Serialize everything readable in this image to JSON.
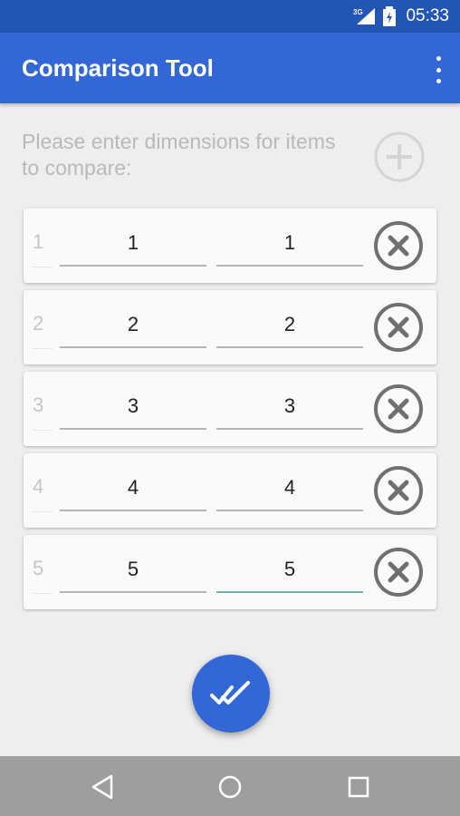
{
  "status_bar": {
    "time": "05:33",
    "network_label": "3G"
  },
  "app_bar": {
    "title": "Comparison Tool",
    "menu_icon": "more-vert-icon"
  },
  "prompt": {
    "text": "Please enter dimensions for items to compare:"
  },
  "rows": [
    {
      "index": "1",
      "value_a": "1",
      "value_b": "1"
    },
    {
      "index": "2",
      "value_a": "2",
      "value_b": "2"
    },
    {
      "index": "3",
      "value_a": "3",
      "value_b": "3"
    },
    {
      "index": "4",
      "value_a": "4",
      "value_b": "4"
    },
    {
      "index": "5",
      "value_a": "5",
      "value_b": "5"
    }
  ],
  "fab": {
    "icon": "double-check-icon"
  },
  "nav": {
    "icons": [
      "back-icon",
      "home-icon",
      "recents-icon"
    ]
  },
  "colors": {
    "primary": "#3367d6",
    "status_bar": "#2255b4",
    "accent": "#6cb3a8"
  }
}
